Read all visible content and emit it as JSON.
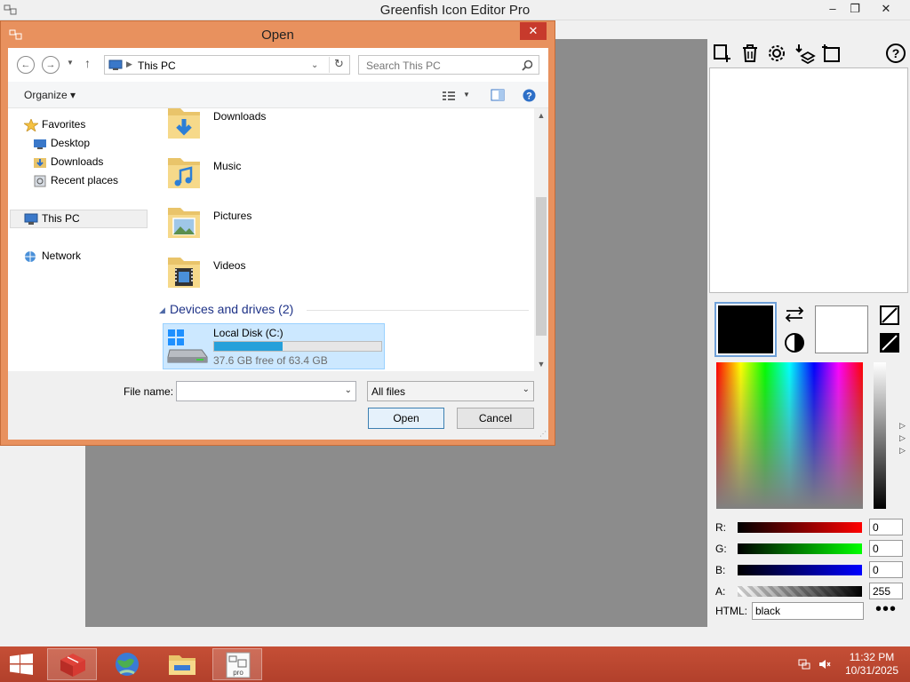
{
  "app": {
    "title": "Greenfish Icon Editor Pro",
    "window_controls": {
      "minimize": "–",
      "restore": "❐",
      "close": "✕"
    }
  },
  "color_panel": {
    "primary_color": "#000000",
    "secondary_color": "#ffffff",
    "r_label": "R:",
    "r_value": "0",
    "g_label": "G:",
    "g_value": "0",
    "b_label": "B:",
    "b_value": "0",
    "a_label": "A:",
    "a_value": "255",
    "html_label": "HTML:",
    "html_value": "black",
    "more_label": "•••"
  },
  "dialog": {
    "title": "Open",
    "close_label": "✕",
    "address": {
      "location": "This PC"
    },
    "search": {
      "placeholder": "Search This PC"
    },
    "organize_label": "Organize ▾",
    "nav": {
      "favorites": "Favorites",
      "desktop": "Desktop",
      "downloads": "Downloads",
      "recent_places": "Recent places",
      "this_pc": "This PC",
      "network": "Network"
    },
    "folders": [
      "Downloads",
      "Music",
      "Pictures",
      "Videos"
    ],
    "devices_header": "Devices and drives (2)",
    "drive": {
      "name": "Local Disk (C:)",
      "free_text": "37.6 GB free of 63.4 GB",
      "used_fraction": 0.407
    },
    "file_name_label": "File name:",
    "file_name_value": "",
    "filter_value": "All files",
    "open_label": "Open",
    "cancel_label": "Cancel"
  },
  "taskbar": {
    "time": "11:32 PM",
    "date": "10/31/2025"
  }
}
